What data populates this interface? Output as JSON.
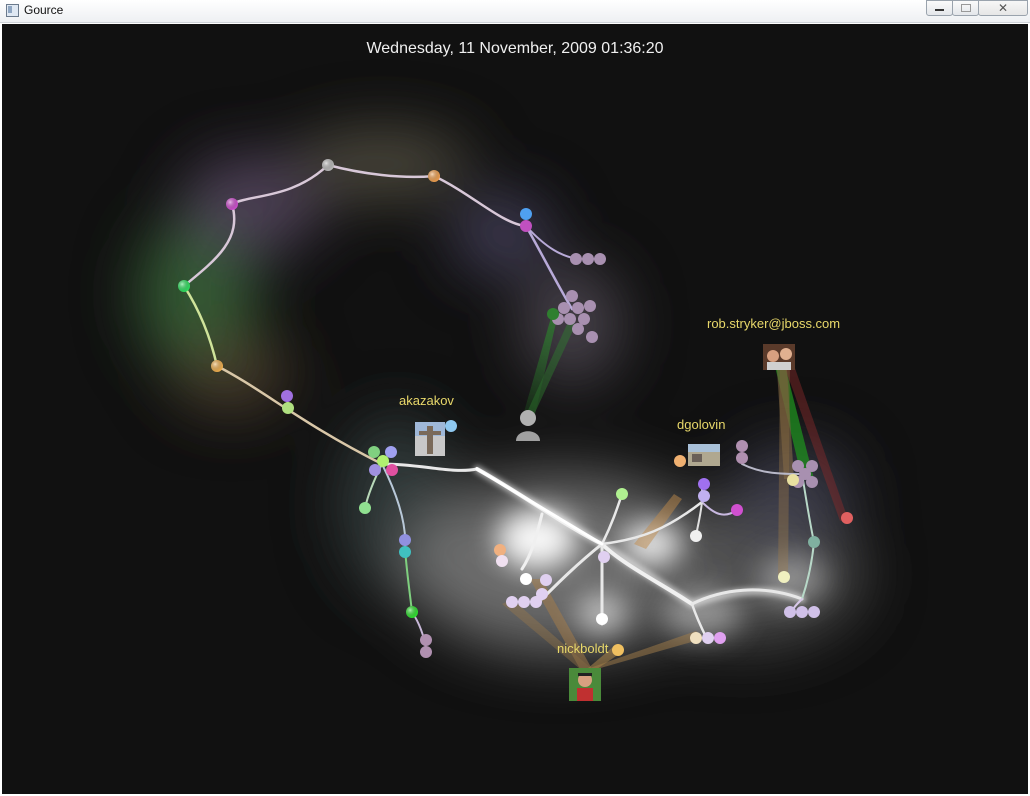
{
  "window": {
    "title": "Gource"
  },
  "visualization": {
    "date": "Wednesday, 11 November, 2009 01:36:20",
    "users": [
      {
        "name": "akazakov"
      },
      {
        "name": "dgolovin"
      },
      {
        "name": "rob.stryker@jboss.com"
      },
      {
        "name": "nickboldt"
      }
    ]
  },
  "colors": {
    "background": "#111111",
    "user_label": "#e8d86a",
    "date_label": "#f0f0f0",
    "branch": "#e8e8e8"
  }
}
